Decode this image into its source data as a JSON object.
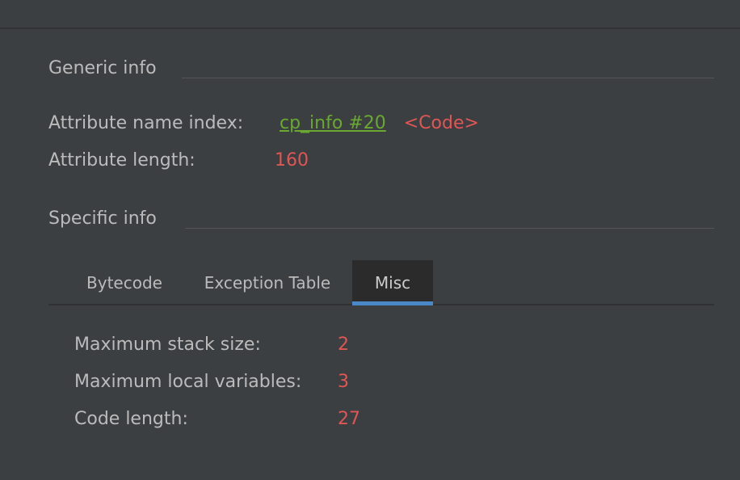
{
  "generic_info": {
    "title": "Generic info",
    "attribute_name_index_label": "Attribute name index:",
    "attribute_name_index_link": "cp_info #20",
    "attribute_name_index_value": "<Code>",
    "attribute_length_label": "Attribute length:",
    "attribute_length_value": "160"
  },
  "specific_info": {
    "title": "Specific info",
    "tabs": [
      {
        "label": "Bytecode",
        "selected": false
      },
      {
        "label": "Exception Table",
        "selected": false
      },
      {
        "label": "Misc",
        "selected": true
      }
    ]
  },
  "misc": {
    "max_stack_label": "Maximum stack size:",
    "max_stack_value": "2",
    "max_locals_label": "Maximum local variables:",
    "max_locals_value": "3",
    "code_length_label": "Code length:",
    "code_length_value": "27"
  },
  "colors": {
    "background": "#3c3f41",
    "text": "#bbbbbb",
    "value_red": "#e05555",
    "link_green": "#6aa832",
    "tab_selected_bg": "#2b2b2b",
    "tab_accent": "#4a88c7"
  }
}
